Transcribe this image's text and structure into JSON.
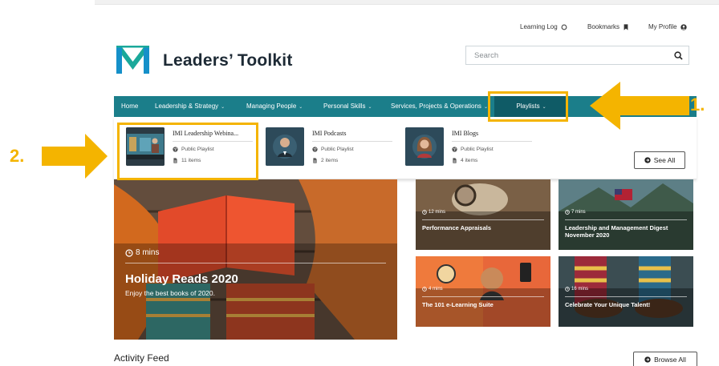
{
  "header": {
    "learning_log": "Learning Log",
    "bookmarks": "Bookmarks",
    "my_profile": "My Profile",
    "brand": "Leaders’ Toolkit"
  },
  "search": {
    "placeholder": "Search"
  },
  "nav": {
    "items": [
      {
        "label": "Home",
        "chevron": ""
      },
      {
        "label": "Leadership & Strategy",
        "chevron": "⌄"
      },
      {
        "label": "Managing People",
        "chevron": "⌄"
      },
      {
        "label": "Personal Skills",
        "chevron": "⌄"
      },
      {
        "label": "Services, Projects & Operations",
        "chevron": "⌄"
      },
      {
        "label": "Playlists",
        "chevron": "⌄"
      }
    ]
  },
  "playlists": [
    {
      "title": "IMI Leadership Webina...",
      "type": "Public Playlist",
      "count": "11 items"
    },
    {
      "title": "IMI Podcasts",
      "type": "Public Playlist",
      "count": "2 items"
    },
    {
      "title": "IMI Blogs",
      "type": "Public Playlist",
      "count": "4 items"
    }
  ],
  "see_all": "See All",
  "hero": {
    "time": "8 mins",
    "title": "Holiday Reads 2020",
    "subtitle": "Enjoy the best books of 2020."
  },
  "tiles": [
    {
      "time": "12 mins",
      "title": "Performance Appraisals"
    },
    {
      "time": "7 mins",
      "title": "Leadership and Management Digest November 2020"
    },
    {
      "time": "4 mins",
      "title": "The 101 e-Learning Suite"
    },
    {
      "time": "16 mins",
      "title": "Celebrate Your Unique Talent!"
    }
  ],
  "activity_feed": "Activity Feed",
  "browse_all": "Browse All",
  "annotations": {
    "one": "1.",
    "two": "2."
  },
  "colors": {
    "nav_bg": "#1b7e8a",
    "nav_active": "#0f5b66",
    "annotation": "#f4b400",
    "logo_blue": "#1590c9",
    "logo_teal": "#1aa89a"
  }
}
